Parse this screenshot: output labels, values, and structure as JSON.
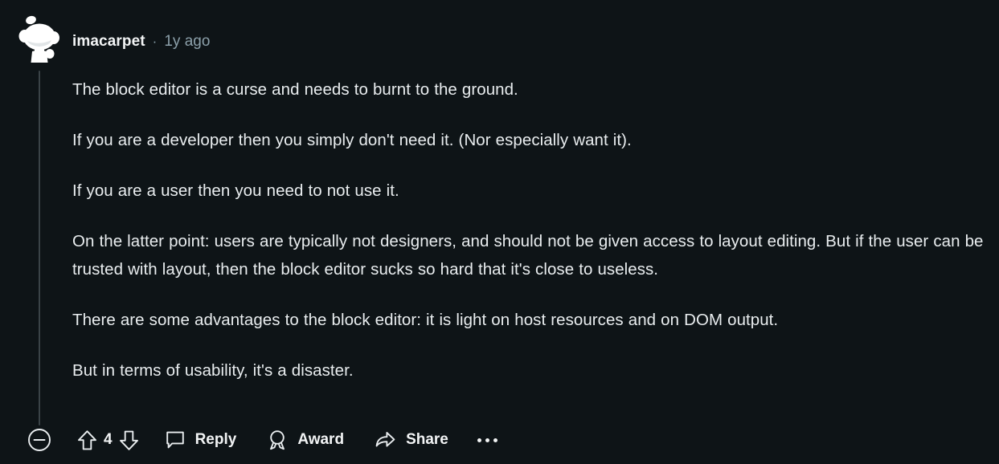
{
  "comment": {
    "author": "imacarpet",
    "separator": "·",
    "timestamp": "1y ago",
    "avatar_icon": "snoo-avatar",
    "paragraphs": [
      "The block editor is a curse and needs to burnt to the ground.",
      "If you are a developer then you simply don't need it. (Nor especially want it).",
      "If you are a user then you need to not use it.",
      "On the latter point: users are typically not designers, and should not be given access to layout editing. But if the user can be trusted with layout, then the block editor sucks so hard that it's close to useless.",
      "There are some advantages to the block editor: it is light on host resources and on DOM output.",
      "But in terms of usability, it's a disaster."
    ]
  },
  "actions": {
    "collapse_icon": "minus-circle-icon",
    "upvote_icon": "upvote-arrow-icon",
    "downvote_icon": "downvote-arrow-icon",
    "vote_count": "4",
    "reply_icon": "speech-bubble-icon",
    "reply_label": "Reply",
    "award_icon": "award-medal-icon",
    "award_label": "Award",
    "share_icon": "share-arrow-icon",
    "share_label": "Share",
    "more_icon": "more-horizontal-icon"
  },
  "theme": {
    "background": "#0e1417",
    "text_primary": "#e9edef",
    "text_muted": "#8ca0aa",
    "thread_line": "#3a4347"
  }
}
